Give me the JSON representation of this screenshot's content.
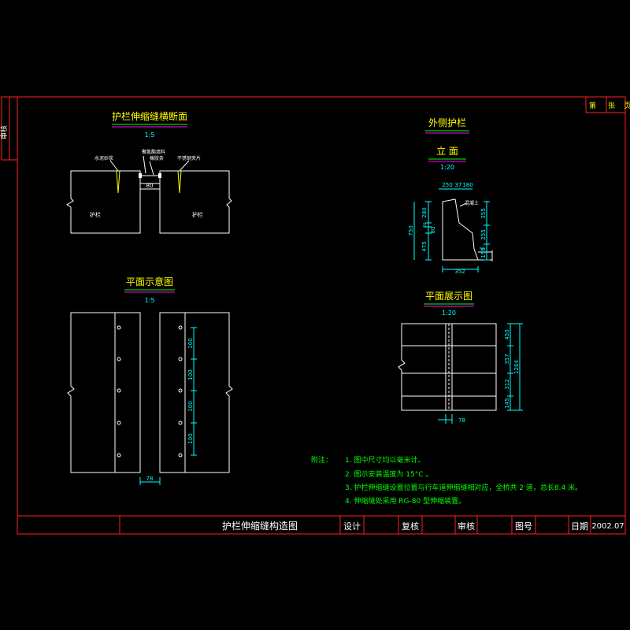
{
  "side_label": "审核",
  "sheet_box": {
    "part1": "第",
    "part2": "张",
    "part3": "页"
  },
  "section_view": {
    "title": "护栏伸缩缝横断面",
    "scale": "1:5",
    "label_left_top": "水泥砂浆",
    "label_gap_fill": "聚氨酯填料",
    "label_gap_rubber": "橡胶条",
    "label_right_top": "不锈钢夹片",
    "gap_dim": "80",
    "body_left": "护栏",
    "body_right": "护栏"
  },
  "plan_view": {
    "title": "平面示意图",
    "scale": "1:5",
    "dims_vertical": [
      "100",
      "100",
      "100",
      "100"
    ],
    "bottom_dim": "78"
  },
  "outer_rail": {
    "title": "外侧护栏",
    "elev_title": "立  面",
    "elev_scale": "1:20",
    "top_dims": [
      "250",
      "37",
      "180"
    ],
    "left_dims": [
      "280",
      "40",
      "80",
      "475"
    ],
    "total_height": "750",
    "right_dims": [
      "355",
      "255",
      "150"
    ],
    "right_dim_small": "50",
    "bottom_dim": "352",
    "label_cap": "混凝土"
  },
  "rail_plan": {
    "title": "平面展示图",
    "scale": "1:20",
    "right_dims": [
      "450",
      "357",
      "312",
      "145"
    ],
    "total": "1264",
    "bottom_dim": "78"
  },
  "notes": {
    "heading": "附注：",
    "items": [
      "1. 图中尺寸均以毫米计。",
      "2. 图示安装温度为 15°C       。",
      "3. 护栏伸缩缝设置位置与行车道伸缩缝相对应，全桥共 2   道，总长8.4       米。",
      "4. 伸缩缝处采用 RG-80        型伸缩装置。"
    ]
  },
  "title_block": {
    "drawing_title": "护栏伸缩缝构造图",
    "design": "设计",
    "review": "复核",
    "audit": "审核",
    "drawing_no": "图号",
    "date_label": "日期",
    "date_value": "2002.07"
  },
  "colors": {
    "frame": "#ff2020",
    "line": "#ffffff",
    "title": "#ffff00",
    "dim": "#00ffff",
    "note": "#00ff00",
    "underline_a": "#00ff00",
    "underline_b": "#ff00ff"
  }
}
